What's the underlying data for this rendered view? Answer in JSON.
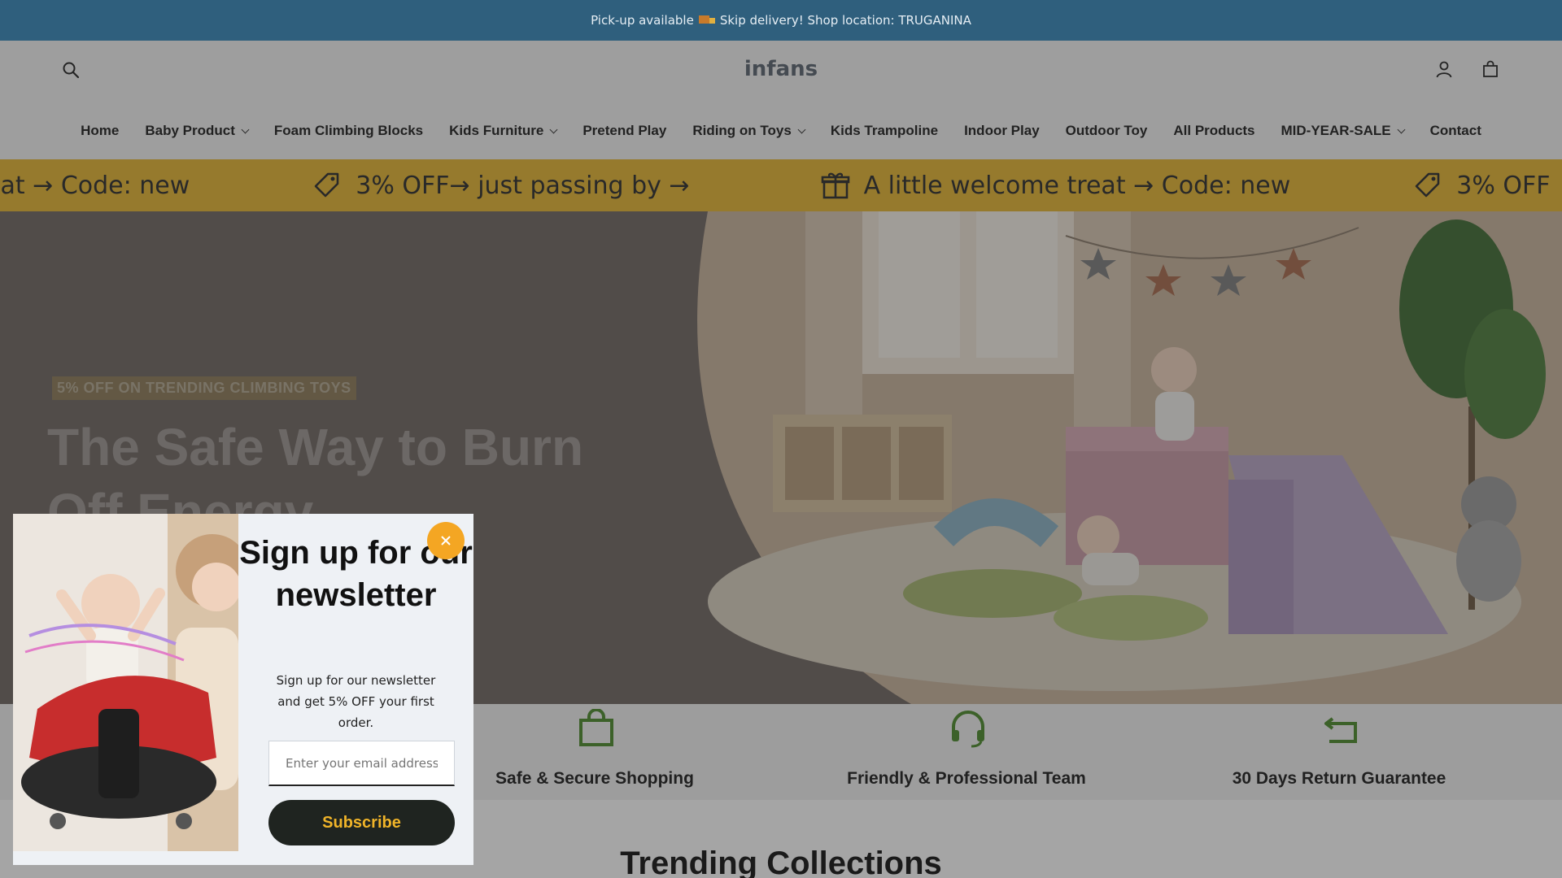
{
  "announcement": {
    "text_before": "Pick-up available",
    "icon": "truck-icon",
    "text_after": "Skip delivery! Shop location: TRUGANINA"
  },
  "header": {
    "logo": "infans",
    "icons": [
      "search-icon",
      "user-icon",
      "shopping-bag-icon"
    ],
    "nav": [
      {
        "label": "Home",
        "dropdown": false
      },
      {
        "label": "Baby Product",
        "dropdown": true
      },
      {
        "label": "Foam Climbing Blocks",
        "dropdown": false
      },
      {
        "label": "Kids Furniture",
        "dropdown": true
      },
      {
        "label": "Pretend Play",
        "dropdown": false
      },
      {
        "label": "Riding on Toys",
        "dropdown": true
      },
      {
        "label": "Kids Trampoline",
        "dropdown": false
      },
      {
        "label": "Indoor Play",
        "dropdown": false
      },
      {
        "label": "Outdoor Toy",
        "dropdown": false
      },
      {
        "label": "All Products",
        "dropdown": false
      },
      {
        "label": "MID-YEAR-SALE",
        "dropdown": true
      },
      {
        "label": "Contact",
        "dropdown": false
      }
    ]
  },
  "marquee": {
    "segments": [
      {
        "icon": "",
        "text": "eat → Code: new"
      },
      {
        "icon": "tag-icon",
        "text": "3% OFF→ just passing by →"
      },
      {
        "icon": "gift-icon",
        "text": "A little welcome treat → Code: new"
      },
      {
        "icon": "tag-icon",
        "text": "3% OFF"
      }
    ]
  },
  "hero": {
    "badge": "5% OFF ON TRENDING CLIMBING TOYS",
    "title": "The Safe Way to Burn Off Energy"
  },
  "features": [
    {
      "icon": "shopping-bag-icon",
      "label": "Safe & Secure Shopping"
    },
    {
      "icon": "headset-icon",
      "label": "Friendly & Professional Team"
    },
    {
      "icon": "return-arrow-icon",
      "label": "30 Days Return Guarantee"
    }
  ],
  "section_heading": "Trending Collections",
  "popup": {
    "title": "Sign up for our newsletter",
    "text": "Sign up for our newsletter and get 5% OFF your first order.",
    "email_placeholder": "Enter your email address",
    "subscribe_label": "Subscribe",
    "close_icon": "close-icon"
  },
  "colors": {
    "announcement_bg": "#2f5f7d",
    "marquee_bg": "#e5b631",
    "feature_icon": "#4a8a2a",
    "subscribe_bg": "#1f2420",
    "subscribe_text": "#f0b429",
    "close_bg": "#f4a623"
  }
}
